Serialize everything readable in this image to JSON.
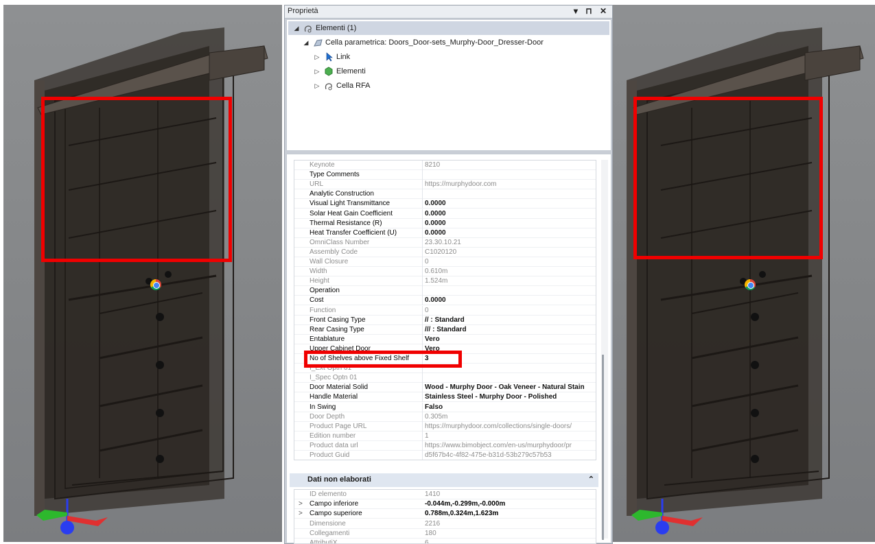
{
  "panel": {
    "title": "Proprietà",
    "header_buttons": "▾ ⊓ ✕"
  },
  "tree": [
    {
      "label": "Elementi (1)",
      "arrow": "◢",
      "icon": "parametric-cell-icon"
    },
    {
      "label": "Cella parametrica: Doors_Door-sets_Murphy-Door_Dresser-Door",
      "arrow": "◢",
      "icon": "cell-icon"
    },
    {
      "label": "Link",
      "arrow": "▷",
      "icon": "link-cursor-icon"
    },
    {
      "label": "Elementi",
      "arrow": "▷",
      "icon": "element-gem-icon"
    },
    {
      "label": "Cella RFA",
      "arrow": "▷",
      "icon": "rfa-cell-icon"
    }
  ],
  "properties": [
    {
      "name": "Keynote",
      "value": "8210",
      "style": "grey"
    },
    {
      "name": "Type Comments",
      "value": "",
      "style": "normal"
    },
    {
      "name": "URL",
      "value": "https://murphydoor.com",
      "style": "grey"
    },
    {
      "name": "Analytic Construction",
      "value": "",
      "style": "normal"
    },
    {
      "name": "Visual Light Transmittance",
      "value": "0.0000",
      "style": "bold"
    },
    {
      "name": "Solar Heat Gain Coefficient",
      "value": "0.0000",
      "style": "bold"
    },
    {
      "name": "Thermal Resistance (R)",
      "value": "0.0000",
      "style": "bold"
    },
    {
      "name": "Heat Transfer Coefficient (U)",
      "value": "0.0000",
      "style": "bold"
    },
    {
      "name": "OmniClass Number",
      "value": "23.30.10.21",
      "style": "grey"
    },
    {
      "name": "Assembly Code",
      "value": "C1020120",
      "style": "grey"
    },
    {
      "name": "Wall Closure",
      "value": "0",
      "style": "grey"
    },
    {
      "name": "Width",
      "value": "0.610m",
      "style": "grey"
    },
    {
      "name": "Height",
      "value": "1.524m",
      "style": "grey"
    },
    {
      "name": "Operation",
      "value": "",
      "style": "normal"
    },
    {
      "name": "Cost",
      "value": "0.0000",
      "style": "bold"
    },
    {
      "name": "Function",
      "value": "0",
      "style": "grey"
    },
    {
      "name": "Front Casing Type",
      "value": "// : Standard",
      "style": "bold"
    },
    {
      "name": "Rear Casing Type",
      "value": "/// : Standard",
      "style": "bold"
    },
    {
      "name": "Entablature",
      "value": "Vero",
      "style": "bold"
    },
    {
      "name": "Upper Cabinet Door",
      "value": "Vero",
      "style": "bold"
    },
    {
      "name": "No of Shelves above Fixed Shelf",
      "value": "3",
      "style": "bold"
    },
    {
      "name": "I_Ext Optn 01",
      "value": "",
      "style": "grey"
    },
    {
      "name": "I_Spec Optn 01",
      "value": "",
      "style": "grey"
    },
    {
      "name": "Door Material Solid",
      "value": "Wood - Murphy Door - Oak Veneer - Natural Stain",
      "style": "bold"
    },
    {
      "name": "Handle Material",
      "value": "Stainless Steel - Murphy Door - Polished",
      "style": "bold"
    },
    {
      "name": "In Swing",
      "value": "Falso",
      "style": "bold"
    },
    {
      "name": "Door Depth",
      "value": "0.305m",
      "style": "grey"
    },
    {
      "name": "Product Page URL",
      "value": "https://murphydoor.com/collections/single-doors/",
      "style": "grey"
    },
    {
      "name": "Edition number",
      "value": "1",
      "style": "grey"
    },
    {
      "name": "Product data url",
      "value": "https://www.bimobject.com/en-us/murphydoor/pr",
      "style": "grey"
    },
    {
      "name": "Product Guid",
      "value": "d5f67b4c-4f82-475e-b31d-53b279c57b53",
      "style": "grey"
    }
  ],
  "raw_section": {
    "title": "Dati non elaborati",
    "collapse_glyph": "⌃",
    "rows": [
      {
        "name": "ID elemento",
        "value": "1410",
        "style": "grey",
        "expander": ""
      },
      {
        "name": "Campo inferiore",
        "value": "-0.044m,-0.299m,-0.000m",
        "style": "bold",
        "expander": ">"
      },
      {
        "name": "Campo superiore",
        "value": "0.788m,0.324m,1.623m",
        "style": "bold",
        "expander": ">"
      },
      {
        "name": "Dimensione",
        "value": "2216",
        "style": "grey",
        "expander": ""
      },
      {
        "name": "Collegamenti",
        "value": "180",
        "style": "grey",
        "expander": ""
      },
      {
        "name": "AttributiX",
        "value": "6",
        "style": "grey",
        "expander": ""
      }
    ]
  },
  "colors": {
    "highlight": "#f00000",
    "viewport_bg": "#868889",
    "model_dark": "#2f2a26"
  },
  "viewports": [
    {
      "name": "left-3d-view",
      "axis_icon": "xyz-axis-gizmo-icon"
    },
    {
      "name": "right-3d-view",
      "axis_icon": "xyz-axis-gizmo-icon"
    }
  ]
}
